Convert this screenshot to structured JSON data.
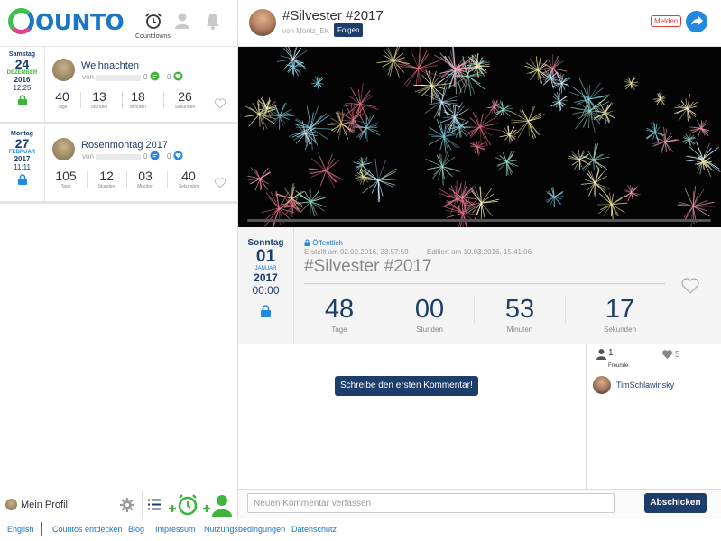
{
  "app": {
    "logo_text": "OUNTO"
  },
  "nav": {
    "countdowns_label": "Countdowns"
  },
  "countdowns": [
    {
      "weekday": "Samstag",
      "day": "24",
      "month": "DEZEMBER",
      "year": "2016",
      "time": "12:25",
      "title": "Weihnachten",
      "by": "von",
      "comments": "0",
      "likes": "0",
      "days": "40",
      "hours": "13",
      "minutes": "18",
      "seconds": "26",
      "lock_color": "#3fb43a"
    },
    {
      "weekday": "Montag",
      "day": "27",
      "month": "FEBRUAR",
      "year": "2017",
      "time": "11:11",
      "title": "Rosenmontag 2017",
      "by": "von",
      "comments": "0",
      "likes": "0",
      "days": "105",
      "hours": "12",
      "minutes": "03",
      "seconds": "40",
      "lock_color": "#2389e0"
    }
  ],
  "units_small": {
    "days": "Tage",
    "hours": "Stunden",
    "minutes": "Minuten",
    "seconds": "Sekunden"
  },
  "left_bottom": {
    "profile": "Mein Profil"
  },
  "footer": {
    "links": [
      "English",
      "Countos entdecken",
      "Blog",
      "Impressum",
      "Nutzungsbedingungen",
      "Datenschutz"
    ]
  },
  "header": {
    "title": "#Silvester #2017",
    "by": "von",
    "author": "Moritz_EK",
    "follow": "Folgen",
    "report": "Melden"
  },
  "detail": {
    "weekday": "Sonntag",
    "day": "01",
    "month": "JANUAR",
    "year": "2017",
    "time": "00:00",
    "visibility": "Öffentlich",
    "created": "Erstellt am 02.02.2016, 23:57:59",
    "edited": "Editiert am 10.03.2016, 15:41:06",
    "title": "#Silvester #2017",
    "days": "48",
    "hours": "00",
    "minutes": "53",
    "seconds": "17",
    "units": {
      "days": "Tage",
      "hours": "Stunden",
      "minutes": "Minuten",
      "seconds": "Sekunden"
    }
  },
  "comments": {
    "first_button": "Schreibe den ersten Kommentar!"
  },
  "friends": {
    "count": "1",
    "label": "Freunde",
    "likes": "5",
    "items": [
      {
        "name": "TimSchlawinsky"
      }
    ]
  },
  "composer": {
    "placeholder": "Neuen Kommentar verfassen",
    "send": "Abschicken"
  },
  "colors": {
    "navy": "#1d3d6b",
    "blue": "#2389e0",
    "green": "#3fb43a",
    "red": "#e03b3b"
  }
}
